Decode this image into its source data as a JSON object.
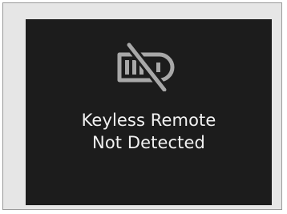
{
  "dashboard_display": {
    "warning_icon": "keyless-remote-crossed-out-icon",
    "message_line1": "Keyless Remote",
    "message_line2": "Not Detected",
    "colors": {
      "screen_background": "#1c1c1c",
      "frame_background": "#e6e6e6",
      "text": "#f2f2f2",
      "icon": "#a8a8a8"
    }
  }
}
